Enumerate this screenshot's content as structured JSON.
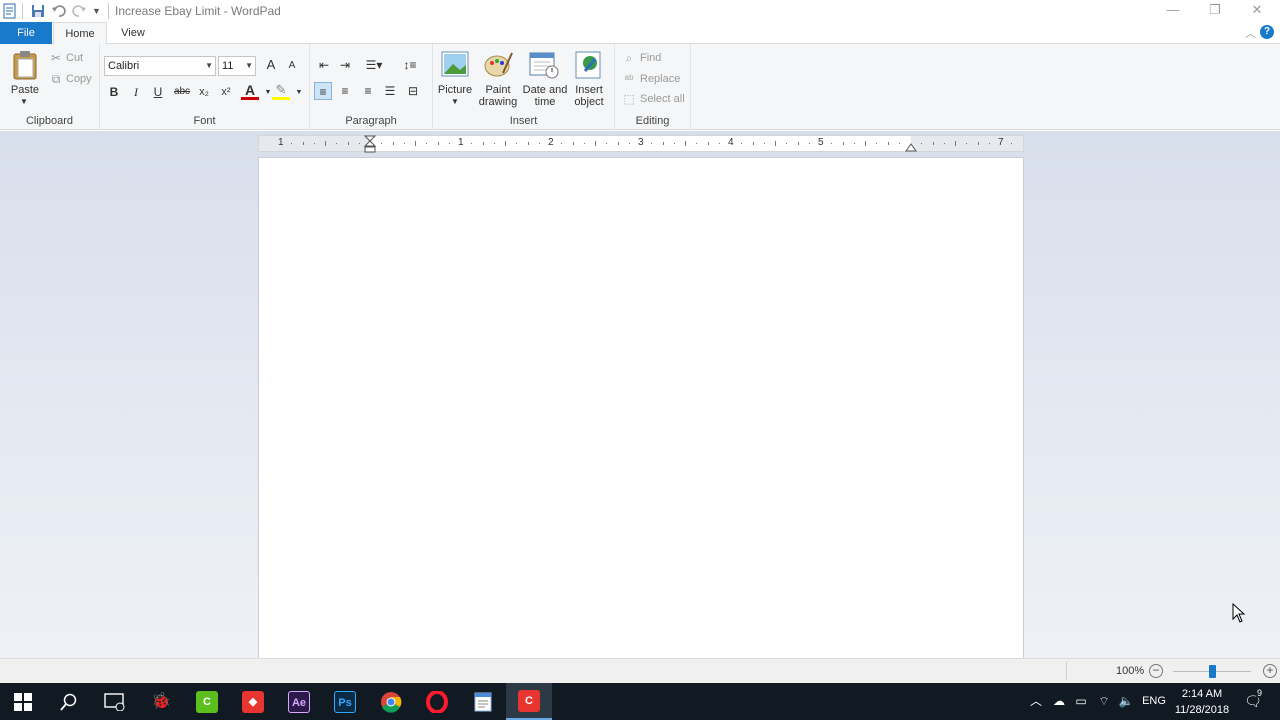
{
  "window": {
    "title": "Increase Ebay Limit - WordPad",
    "controls": {
      "minimize": "—",
      "restore": "❐",
      "close": "✕"
    }
  },
  "tabs": [
    {
      "label": "File"
    },
    {
      "label": "Home"
    },
    {
      "label": "View"
    }
  ],
  "ribbon": {
    "clipboard": {
      "label": "Clipboard",
      "paste": "Paste",
      "cut": "Cut",
      "copy": "Copy"
    },
    "font": {
      "label": "Font",
      "family": "Calibri",
      "size": "11",
      "grow": "A",
      "shrink": "A",
      "bold": "B",
      "italic": "I",
      "underline": "U",
      "strikethrough": "abc",
      "subscript": "x₂",
      "superscript": "x²",
      "text_color": "A",
      "highlight_color": "#ffff00",
      "text_color_bar": "#cc0000"
    },
    "paragraph": {
      "label": "Paragraph"
    },
    "insert": {
      "label": "Insert",
      "picture": "Picture",
      "paint_line1": "Paint",
      "paint_line2": "drawing",
      "datetime_line1": "Date and",
      "datetime_line2": "time",
      "object_line1": "Insert",
      "object_line2": "object"
    },
    "editing": {
      "label": "Editing",
      "find": "Find",
      "replace": "Replace",
      "select_all": "Select all"
    }
  },
  "ruler": {
    "numbers": [
      "1",
      "1",
      "2",
      "3",
      "4",
      "5",
      "7"
    ]
  },
  "statusbar": {
    "zoom": "100%",
    "zoom_level_fraction": 0.5
  },
  "taskbar": {
    "apps": [
      {
        "name": "search-icon"
      },
      {
        "name": "task-view-icon"
      },
      {
        "name": "game-app-icon",
        "color": "#8a6a2a"
      },
      {
        "name": "camtasia-green-icon",
        "label": "C",
        "color": "#5bbf1d"
      },
      {
        "name": "anydesk-icon",
        "label": "◆",
        "color": "#e8352f"
      },
      {
        "name": "after-effects-icon",
        "label": "Ae",
        "color": "#2a1a4a"
      },
      {
        "name": "photoshop-icon",
        "label": "Ps",
        "color": "#0b2b45"
      },
      {
        "name": "chrome-icon"
      },
      {
        "name": "opera-icon"
      },
      {
        "name": "wordpad-icon"
      },
      {
        "name": "camtasia-red-icon",
        "label": "C",
        "color": "#e8352f"
      }
    ],
    "language": "ENG",
    "time": "2:14 AM",
    "date": "11/28/2018",
    "notification_count": "9"
  }
}
